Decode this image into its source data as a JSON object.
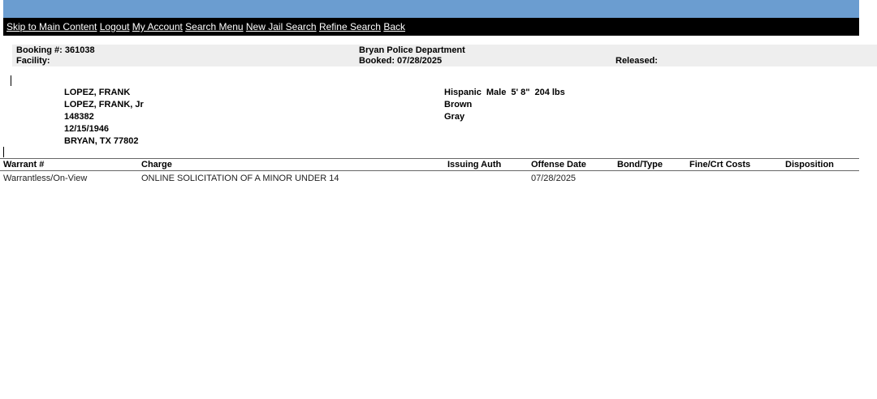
{
  "nav": {
    "items": [
      "Skip to Main Content",
      "Logout",
      "My Account",
      "Search Menu",
      "New Jail Search",
      "Refine Search",
      " Back"
    ]
  },
  "booking": {
    "booking_label": "Booking #: 361038",
    "facility_label": "Facility:",
    "agency": "Bryan Police Department",
    "booked_label": "Booked: 07/28/2025",
    "released_label": "Released:"
  },
  "person": {
    "name": "LOPEZ, FRANK",
    "alias": "LOPEZ, FRANK, Jr",
    "id": "148382",
    "dob": "12/15/1946",
    "city": "BRYAN, TX 77802"
  },
  "physical": {
    "race": "Hispanic",
    "sex": "Male",
    "height": "5' 8\"",
    "weight": "204 lbs",
    "hair": "Brown",
    "eyes": "Gray"
  },
  "charges": {
    "headers": [
      "Warrant #",
      "Charge",
      "Issuing Auth",
      "Offense Date",
      "Bond/Type",
      "Fine/Crt Costs",
      "Disposition"
    ],
    "rows": [
      [
        "Warrantless/On-View",
        "ONLINE SOLICITATION OF A MINOR UNDER 14",
        "",
        "07/28/2025",
        "",
        "",
        ""
      ]
    ]
  }
}
